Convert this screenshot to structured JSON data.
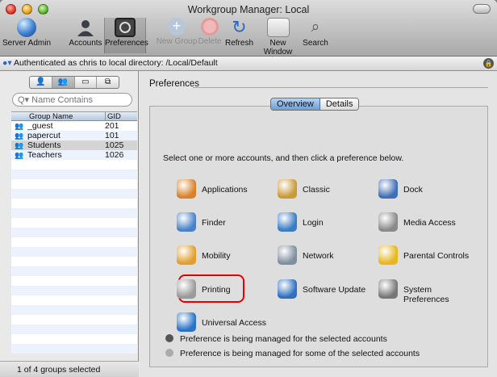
{
  "window": {
    "title": "Workgroup Manager: Local"
  },
  "toolbar": {
    "items": [
      {
        "label": "Server Admin",
        "icon": "globe-icon",
        "state": "enabled"
      },
      {
        "label": "Accounts",
        "icon": "user-icon",
        "state": "enabled"
      },
      {
        "label": "Preferences",
        "icon": "preferences-icon",
        "state": "selected"
      },
      {
        "label": "New Group",
        "icon": "plus-icon",
        "state": "disabled"
      },
      {
        "label": "Delete",
        "icon": "delete-icon",
        "state": "disabled"
      },
      {
        "label": "Refresh",
        "icon": "refresh-icon",
        "state": "enabled"
      },
      {
        "label": "New Window",
        "icon": "new-window-icon",
        "state": "enabled"
      },
      {
        "label": "Search",
        "icon": "search-icon",
        "state": "enabled"
      }
    ]
  },
  "auth": {
    "text": "Authenticated as chris to local directory: /Local/Default"
  },
  "sidebar": {
    "search_placeholder": "Name Contains",
    "columns": {
      "name": "Group Name",
      "gid": "GID"
    },
    "groups": [
      {
        "name": "_guest",
        "gid": "201"
      },
      {
        "name": "papercut",
        "gid": "101"
      },
      {
        "name": "Students",
        "gid": "1025",
        "selected": true
      },
      {
        "name": "Teachers",
        "gid": "1026"
      }
    ],
    "status": "1 of 4 groups selected"
  },
  "main": {
    "section_title": "Preferences",
    "tabs": [
      {
        "label": "Overview",
        "selected": true
      },
      {
        "label": "Details",
        "selected": false
      }
    ],
    "instruction": "Select one or more accounts, and then click a preference below.",
    "prefs": [
      {
        "label": "Applications",
        "icon": "applications-icon",
        "color": "#d9822b"
      },
      {
        "label": "Classic",
        "icon": "classic-icon",
        "color": "#c99a3a"
      },
      {
        "label": "Dock",
        "icon": "dock-icon",
        "color": "#3f6fb5"
      },
      {
        "label": "Finder",
        "icon": "finder-icon",
        "color": "#4a82c9"
      },
      {
        "label": "Login",
        "icon": "login-icon",
        "color": "#3b7cc4"
      },
      {
        "label": "Media Access",
        "icon": "media-access-icon",
        "color": "#8a8a8a"
      },
      {
        "label": "Mobility",
        "icon": "mobility-icon",
        "color": "#e0a030"
      },
      {
        "label": "Network",
        "icon": "network-icon",
        "color": "#7f8f9f"
      },
      {
        "label": "Parental Controls",
        "icon": "parental-controls-icon",
        "color": "#e8b620"
      },
      {
        "label": "Printing",
        "icon": "printer-icon",
        "color": "#9a9a9a",
        "highlighted": true
      },
      {
        "label": "Software Update",
        "icon": "software-update-icon",
        "color": "#2f6fc0"
      },
      {
        "label": "System Preferences",
        "icon": "system-preferences-icon",
        "color": "#777777"
      },
      {
        "label": "Universal Access",
        "icon": "universal-access-icon",
        "color": "#2a73c8"
      }
    ],
    "legend": [
      {
        "text": "Preference is being managed for the selected accounts",
        "icon": "managed-dot-icon"
      },
      {
        "text": "Preference is being managed for some of the selected accounts",
        "icon": "partially-managed-dot-icon"
      }
    ]
  }
}
